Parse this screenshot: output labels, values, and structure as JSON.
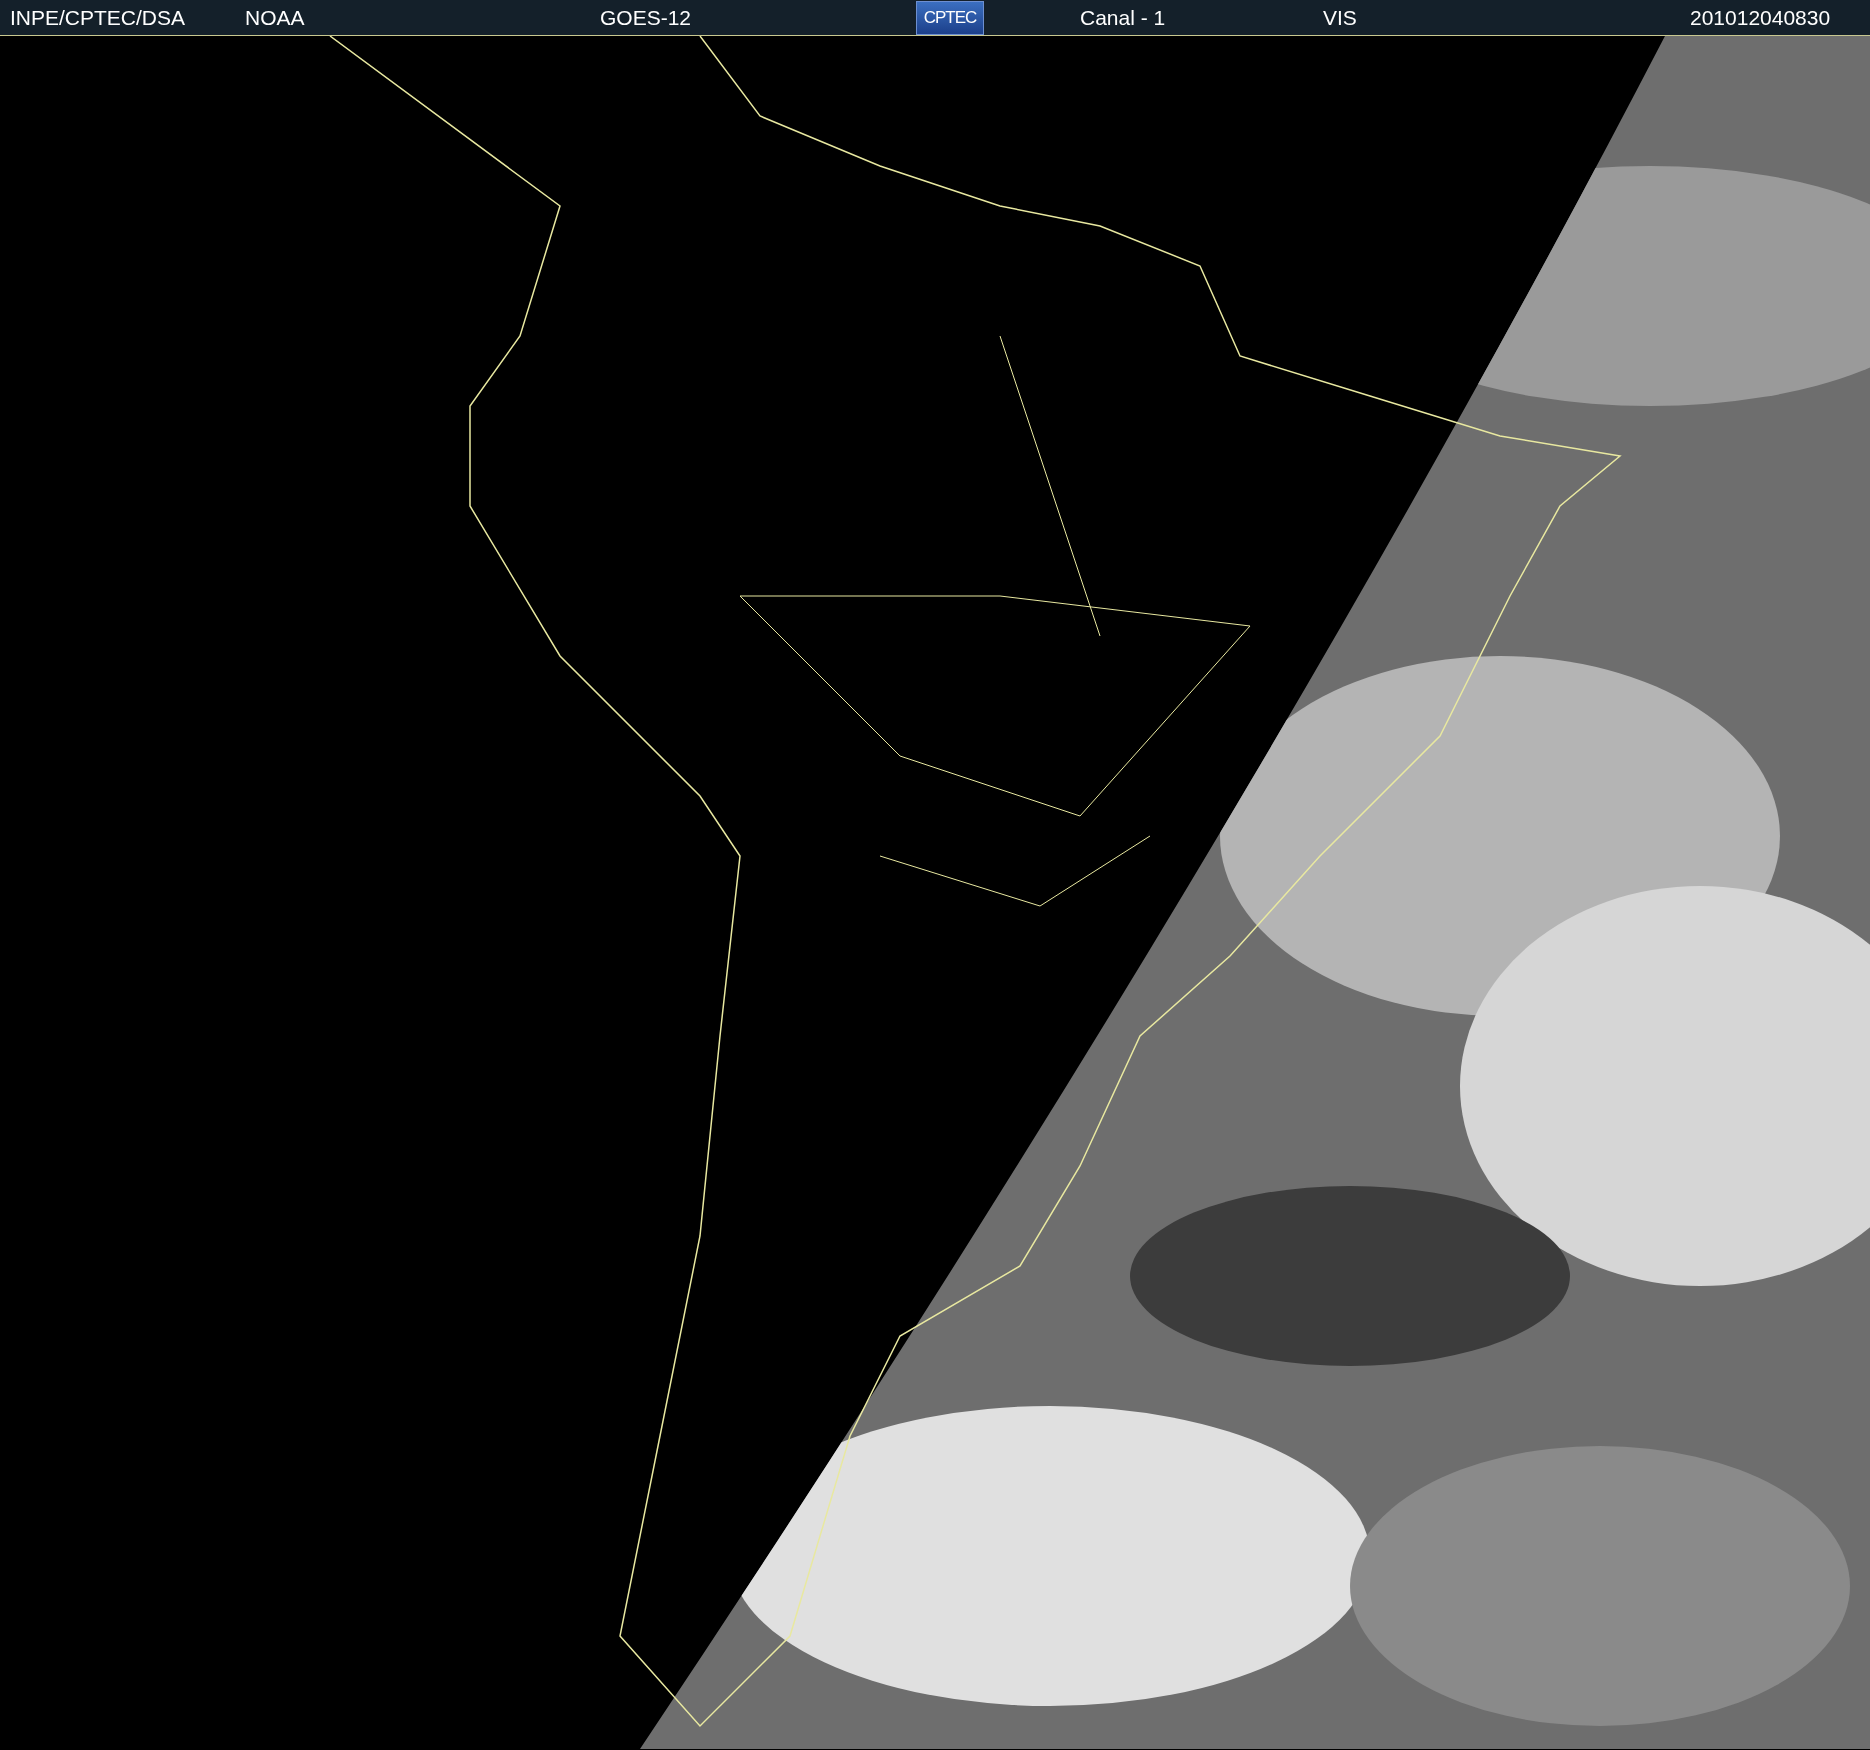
{
  "header": {
    "items": [
      {
        "kind": "text",
        "text": "INPE/CPTEC/DSA"
      },
      {
        "kind": "text",
        "text": "NOAA"
      },
      {
        "kind": "text",
        "text": "GOES-12"
      },
      {
        "kind": "logo",
        "text": "CPTEC"
      },
      {
        "kind": "text",
        "text": "Canal - 1"
      },
      {
        "kind": "text",
        "text": "VIS"
      },
      {
        "kind": "text",
        "text": "201012040830"
      }
    ]
  }
}
